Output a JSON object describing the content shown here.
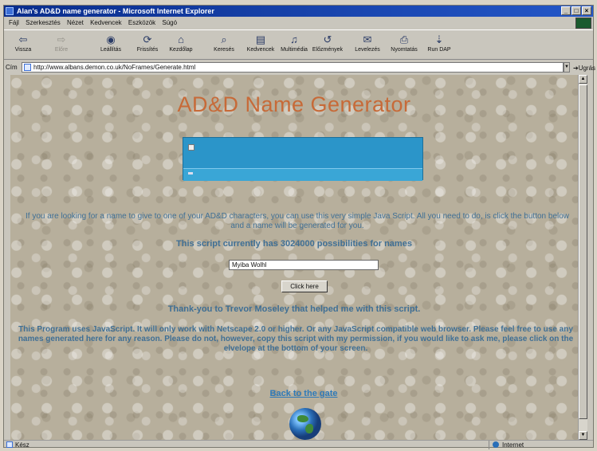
{
  "window": {
    "title": "Alan's AD&D name generator - Microsoft Internet Explorer"
  },
  "menu": [
    "Fájl",
    "Szerkesztés",
    "Nézet",
    "Kedvencek",
    "Eszközök",
    "Súgó"
  ],
  "toolbar": {
    "back": "Vissza",
    "forward": "Előre",
    "stop": "Leállítás",
    "refresh": "Frissítés",
    "home": "Kezdőlap",
    "search": "Keresés",
    "favorites": "Kedvencek",
    "media": "Multimédia",
    "history": "Előzmények",
    "mail": "Levelezés",
    "print": "Nyomtatás",
    "run": "Run DAP"
  },
  "address": {
    "label": "Cím",
    "url": "http://www.albans.demon.co.uk/NoFrames/Generate.html",
    "go": "Ugrás"
  },
  "page": {
    "title": "AD&D Name Generator",
    "intro": "If you are looking for a name to give to one of your AD&D characters, you can use this very simple Java Script. All you need to do, is click the button below and a name will be generated for you.",
    "possibilities": "This script currently has 3024000 possibilities for names",
    "name_value": "Myiba Wolhl",
    "button_label": "Click here",
    "thanks": "Thank-you to Trevor Moseley that helped me with this script.",
    "program_note": "This Program uses JavaScript. It will only work with Netscape 2.0 or higher. Or any JavaScript compatible web browser. Please feel free to use any names generated here for any reason. Please do not, however, copy this script with my permission, if you would like to ask me, please click on the elvelope at the bottom of your screen.",
    "back_link": "Back to the gate"
  },
  "status": {
    "text": "Kész",
    "zone": "Internet"
  }
}
